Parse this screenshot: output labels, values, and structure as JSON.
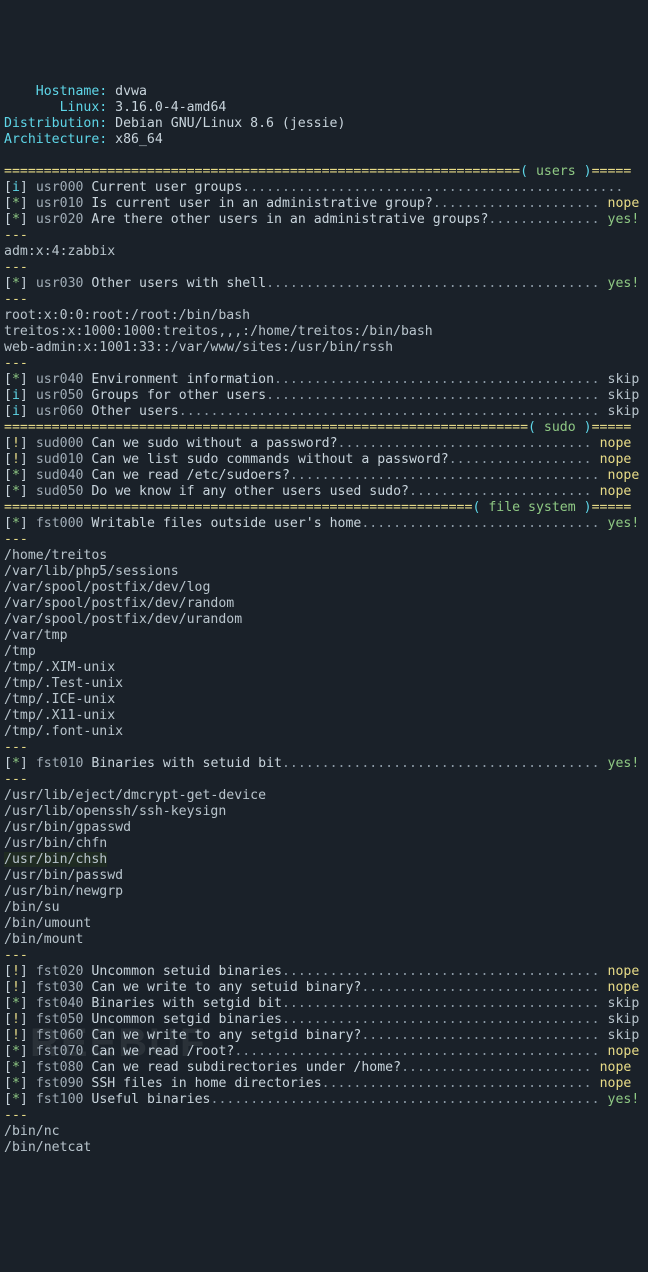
{
  "header": {
    "labels": {
      "hostname": "    Hostname:",
      "linux": "       Linux:",
      "distro": "Distribution:",
      "arch": "Architecture:"
    },
    "values": {
      "hostname": "dvwa",
      "linux": "3.16.0-4-amd64",
      "distro": "Debian GNU/Linux 8.6 (jessie)",
      "arch": "x86_64"
    }
  },
  "sections": {
    "users": "users",
    "sudo": "sudo",
    "fs": "file system"
  },
  "lines": [
    {
      "flag": "i",
      "code": "usr000",
      "desc": "Current user groups",
      "dots": "................................................",
      "res": ""
    },
    {
      "flag": "*",
      "code": "usr010",
      "desc": "Is current user in an administrative group?",
      "dots": ".....................",
      "res": "nope"
    },
    {
      "flag": "*",
      "code": "usr020",
      "desc": "Are there other users in an administrative groups?",
      "dots": "..............",
      "res": "yes!"
    }
  ],
  "body_adm": "adm:x:4:zabbix",
  "usr030": {
    "flag": "*",
    "code": "usr030",
    "desc": "Other users with shell",
    "dots": "..........................................",
    "res": "yes!"
  },
  "body_shell": [
    "root:x:0:0:root:/root:/bin/bash",
    "treitos:x:1000:1000:treitos,,,:/home/treitos:/bin/bash",
    "web-admin:x:1001:33::/var/www/sites:/usr/bin/rssh"
  ],
  "usr_tail": [
    {
      "flag": "*",
      "code": "usr040",
      "desc": "Environment information",
      "dots": ".........................................",
      "res": "skip"
    },
    {
      "flag": "i",
      "code": "usr050",
      "desc": "Groups for other users",
      "dots": "..........................................",
      "res": "skip"
    },
    {
      "flag": "i",
      "code": "usr060",
      "desc": "Other users",
      "dots": ".....................................................",
      "res": "skip"
    }
  ],
  "sudo_lines": [
    {
      "flag": "!",
      "code": "sud000",
      "desc": "Can we sudo without a password?",
      "dots": "................................",
      "res": "nope"
    },
    {
      "flag": "!",
      "code": "sud010",
      "desc": "Can we list sudo commands without a password?",
      "dots": "..................",
      "res": "nope"
    },
    {
      "flag": "*",
      "code": "sud040",
      "desc": "Can we read /etc/sudoers?",
      "dots": ".......................................",
      "res": "nope"
    },
    {
      "flag": "*",
      "code": "sud050",
      "desc": "Do we know if any other users used sudo?",
      "dots": ".......................",
      "res": "nope"
    }
  ],
  "fst000": {
    "flag": "*",
    "code": "fst000",
    "desc": "Writable files outside user's home",
    "dots": "..............................",
    "res": "yes!"
  },
  "body_writable": [
    "/home/treitos",
    "/var/lib/php5/sessions",
    "/var/spool/postfix/dev/log",
    "/var/spool/postfix/dev/random",
    "/var/spool/postfix/dev/urandom",
    "/var/tmp",
    "/tmp",
    "/tmp/.XIM-unix",
    "/tmp/.Test-unix",
    "/tmp/.ICE-unix",
    "/tmp/.X11-unix",
    "/tmp/.font-unix"
  ],
  "fst010": {
    "flag": "*",
    "code": "fst010",
    "desc": "Binaries with setuid bit",
    "dots": "........................................",
    "res": "yes!"
  },
  "body_setuid": [
    "/usr/lib/eject/dmcrypt-get-device",
    "/usr/lib/openssh/ssh-keysign",
    "/usr/bin/gpasswd",
    "/usr/bin/chfn",
    "/usr/bin/chsh",
    "/usr/bin/passwd",
    "/usr/bin/newgrp",
    "/bin/su",
    "/bin/umount",
    "/bin/mount"
  ],
  "fst_tail": [
    {
      "flag": "!",
      "code": "fst020",
      "desc": "Uncommon setuid binaries",
      "dots": "........................................",
      "res": "nope"
    },
    {
      "flag": "!",
      "code": "fst030",
      "desc": "Can we write to any setuid binary?",
      "dots": "..............................",
      "res": "nope"
    },
    {
      "flag": "*",
      "code": "fst040",
      "desc": "Binaries with setgid bit",
      "dots": "........................................",
      "res": "skip"
    },
    {
      "flag": "!",
      "code": "fst050",
      "desc": "Uncommon setgid binaries",
      "dots": "........................................",
      "res": "skip"
    },
    {
      "flag": "!",
      "code": "fst060",
      "desc": "Can we write to any setgid binary?",
      "dots": "..............................",
      "res": "skip"
    },
    {
      "flag": "*",
      "code": "fst070",
      "desc": "Can we read /root?",
      "dots": "..............................................",
      "res": "nope"
    },
    {
      "flag": "*",
      "code": "fst080",
      "desc": "Can we read subdirectories under /home?",
      "dots": "........................",
      "res": "nope"
    },
    {
      "flag": "*",
      "code": "fst090",
      "desc": "SSH files in home directories",
      "dots": "..................................",
      "res": "nope"
    },
    {
      "flag": "*",
      "code": "fst100",
      "desc": "Useful binaries",
      "dots": ".................................................",
      "res": "yes!"
    }
  ],
  "body_useful": [
    "/bin/nc",
    "/bin/netcat"
  ],
  "dash": "---",
  "watermark": "REEBUF"
}
